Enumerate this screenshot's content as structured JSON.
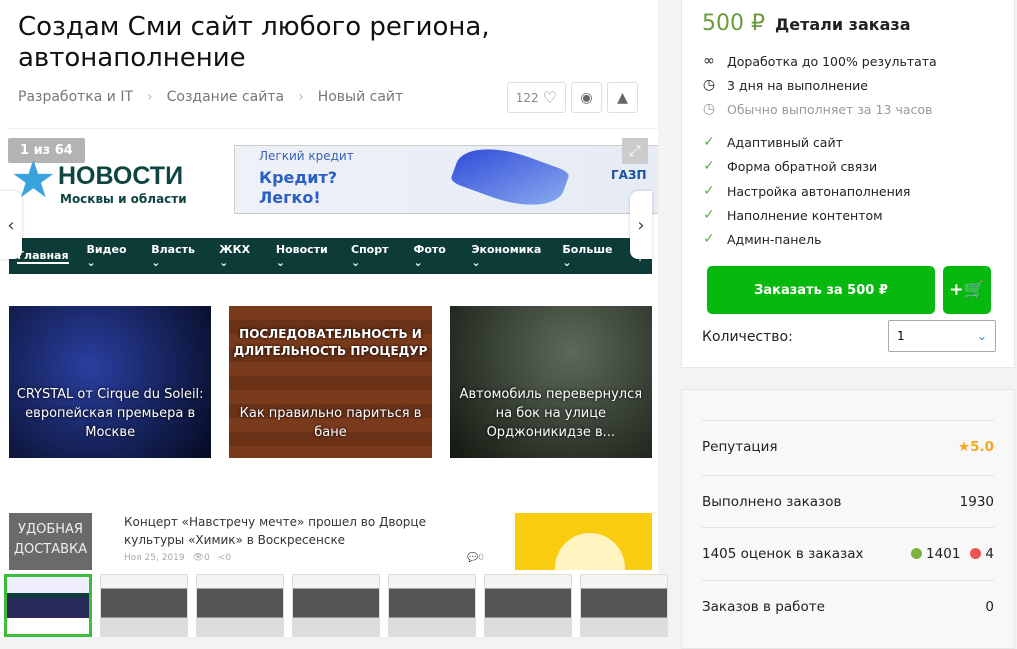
{
  "title": "Создам Сми сайт любого региона, автонаполнение",
  "breadcrumbs": [
    "Разработка и IT",
    "Создание сайта",
    "Новый сайт"
  ],
  "likes": "122",
  "gallery": {
    "counter": "1 из 64",
    "logo_title": "НОВОСТИ",
    "logo_subtitle": "Москвы и области",
    "ad": {
      "label": "Легкий кредит",
      "headline1": "Кредит?",
      "headline2": "Легко!",
      "brand": "ГАЗП"
    },
    "nav": [
      "Главная",
      "Видео ⌄",
      "Власть ⌄",
      "ЖКХ ⌄",
      "Новости ⌄",
      "Спорт ⌄",
      "Фото ⌄",
      "Экономика ⌄",
      "Больше ⌄"
    ],
    "cards": [
      {
        "title": "CRYSTAL от Cirque du Soleil: европейская премьера в Москве"
      },
      {
        "overlay": "ПОСЛЕДОВАТЕЛЬНОСТЬ И ДЛИТЕЛЬНОСТЬ ПРОЦЕДУР",
        "title": "Как правильно париться в бане"
      },
      {
        "title": "Автомобиль перевернулся на бок на улице Орджоникидзе в..."
      }
    ],
    "delivery": "УДОБНАЯ ДОСТАВКА",
    "news_title": "Концерт «Навстречу мечте» прошел во Дворце культуры «Химик» в Воскресенске",
    "news_date": "Ноя 25, 2019",
    "news_views": "0",
    "news_shares": "0",
    "news_comments": "0"
  },
  "order": {
    "price": "500 ₽",
    "title": "Детали заказа",
    "terms": [
      {
        "icon": "infinity-icon",
        "text": "Доработка до 100% результата"
      },
      {
        "icon": "clock-icon",
        "text": "3 дня на выполнение"
      },
      {
        "icon": "clock-muted-icon",
        "text": "Обычно выполняет за 13 часов"
      }
    ],
    "features": [
      "Адаптивный сайт",
      "Форма обратной связи",
      "Настройка автонаполнения",
      "Наполнение контентом",
      "Админ-панель"
    ],
    "button": "Заказать за 500 ₽",
    "cart_label": "+",
    "quantity_label": "Количество:",
    "quantity": "1"
  },
  "stats": {
    "reputation_label": "Репутация",
    "reputation": "5.0",
    "completed_label": "Выполнено заказов",
    "completed": "1930",
    "ratings_label": "1405 оценок в заказах",
    "positive": "1401",
    "negative": "4",
    "in_work_label": "Заказов в работе",
    "in_work": "0",
    "colors": {
      "positive": "#7cb342",
      "negative": "#ef5350",
      "star": "#f5a623"
    }
  }
}
